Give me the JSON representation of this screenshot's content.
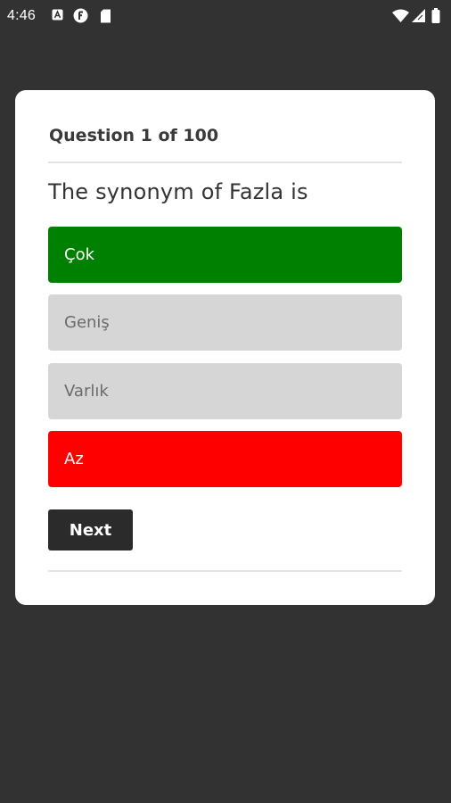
{
  "status_bar": {
    "time": "4:46",
    "left_icons": [
      "notification-a-icon",
      "notification-f-icon",
      "sim-card-icon"
    ],
    "right_icons": [
      "wifi-icon",
      "cell-signal-icon",
      "battery-icon"
    ]
  },
  "quiz": {
    "counter": "Question 1 of 100",
    "question": "The synonym of Fazla is",
    "options": [
      {
        "label": "Çok",
        "state": "correct"
      },
      {
        "label": "Geniş",
        "state": "neutral"
      },
      {
        "label": "Varlık",
        "state": "neutral"
      },
      {
        "label": "Az",
        "state": "wrong"
      }
    ],
    "next_label": "Next"
  },
  "colors": {
    "background": "#323232",
    "card": "#ffffff",
    "correct": "#008000",
    "wrong": "#ff0000",
    "neutral": "#d6d6d6",
    "button": "#2b2b2b"
  }
}
